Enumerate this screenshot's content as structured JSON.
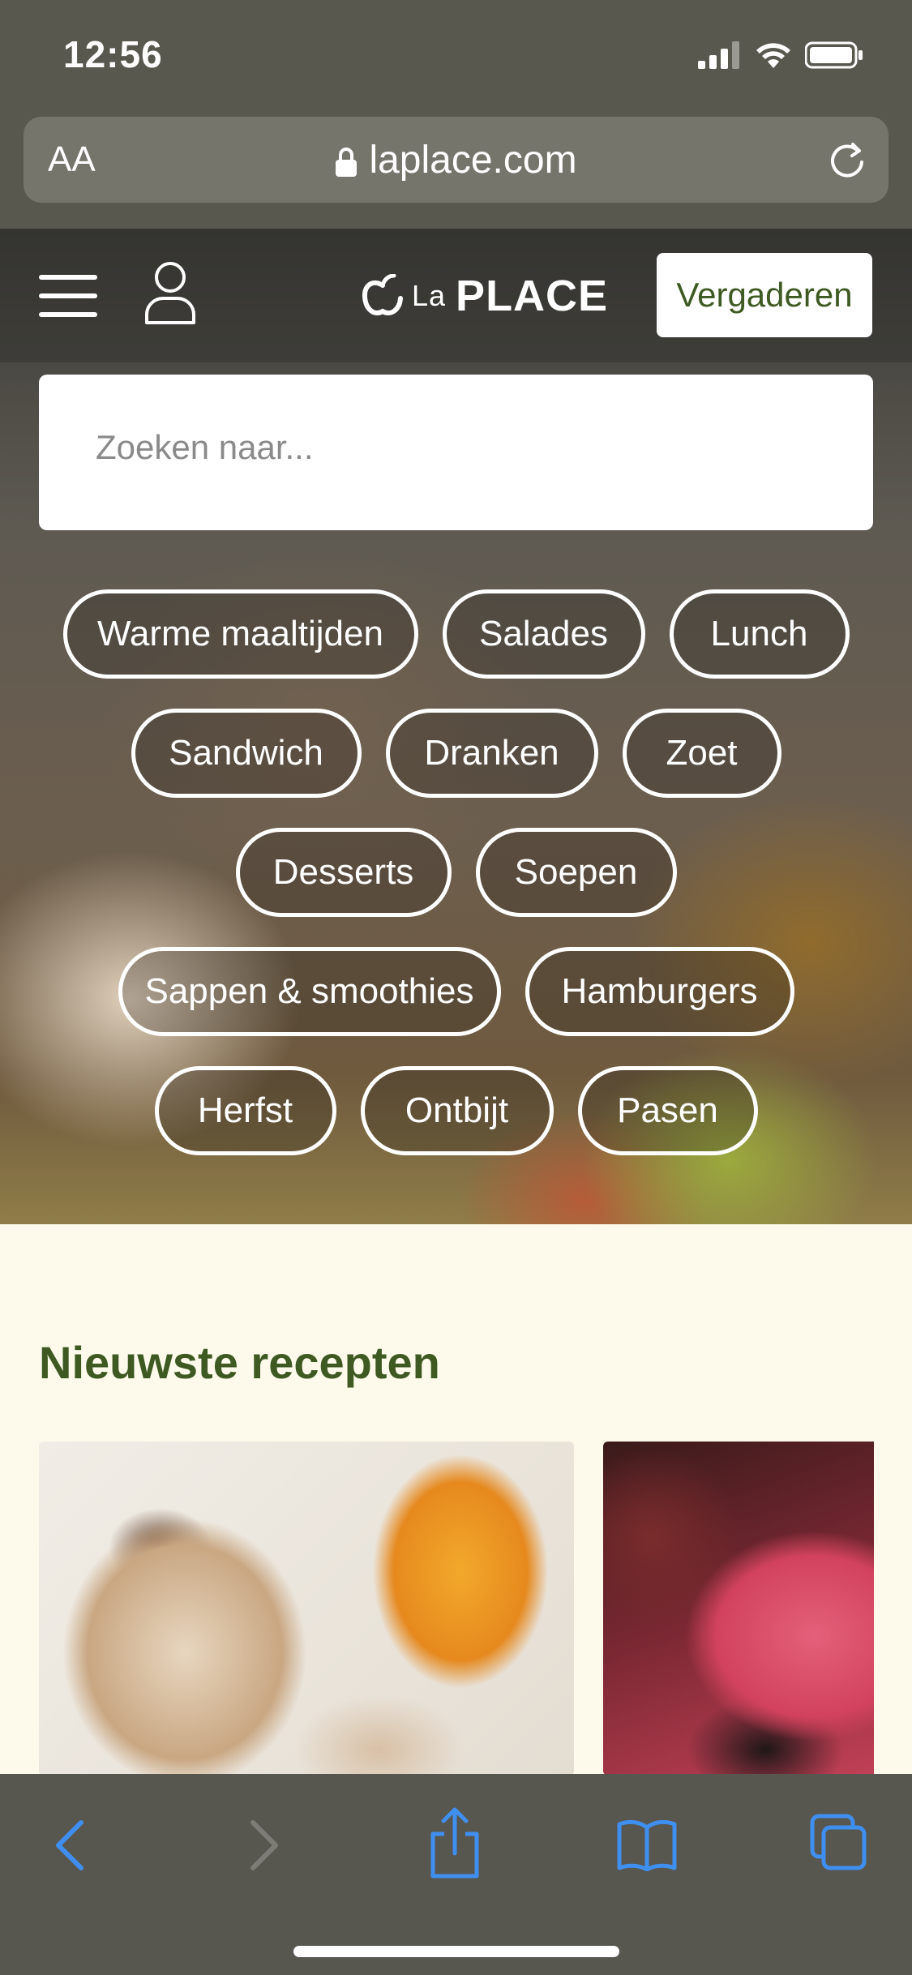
{
  "status": {
    "time": "12:56"
  },
  "browser": {
    "aa_label": "AA",
    "url": "laplace.com"
  },
  "header": {
    "logo_text": "PLACE",
    "logo_prefix": "La",
    "meet_button": "Vergaderen"
  },
  "search": {
    "placeholder": "Zoeken naar..."
  },
  "tags": [
    [
      "Warme maaltijden",
      "Salades",
      "Lunch"
    ],
    [
      "Sandwich",
      "Dranken",
      "Zoet"
    ],
    [
      "Desserts",
      "Soepen"
    ],
    [
      "Sappen & smoothies",
      "Hamburgers"
    ],
    [
      "Herfst",
      "Ontbijt",
      "Pasen"
    ]
  ],
  "content": {
    "section_title": "Nieuwste recepten"
  },
  "colors": {
    "accent_green": "#3e5a22",
    "ios_blue": "#3f8ff0",
    "page_bg": "#fdfaeb"
  }
}
